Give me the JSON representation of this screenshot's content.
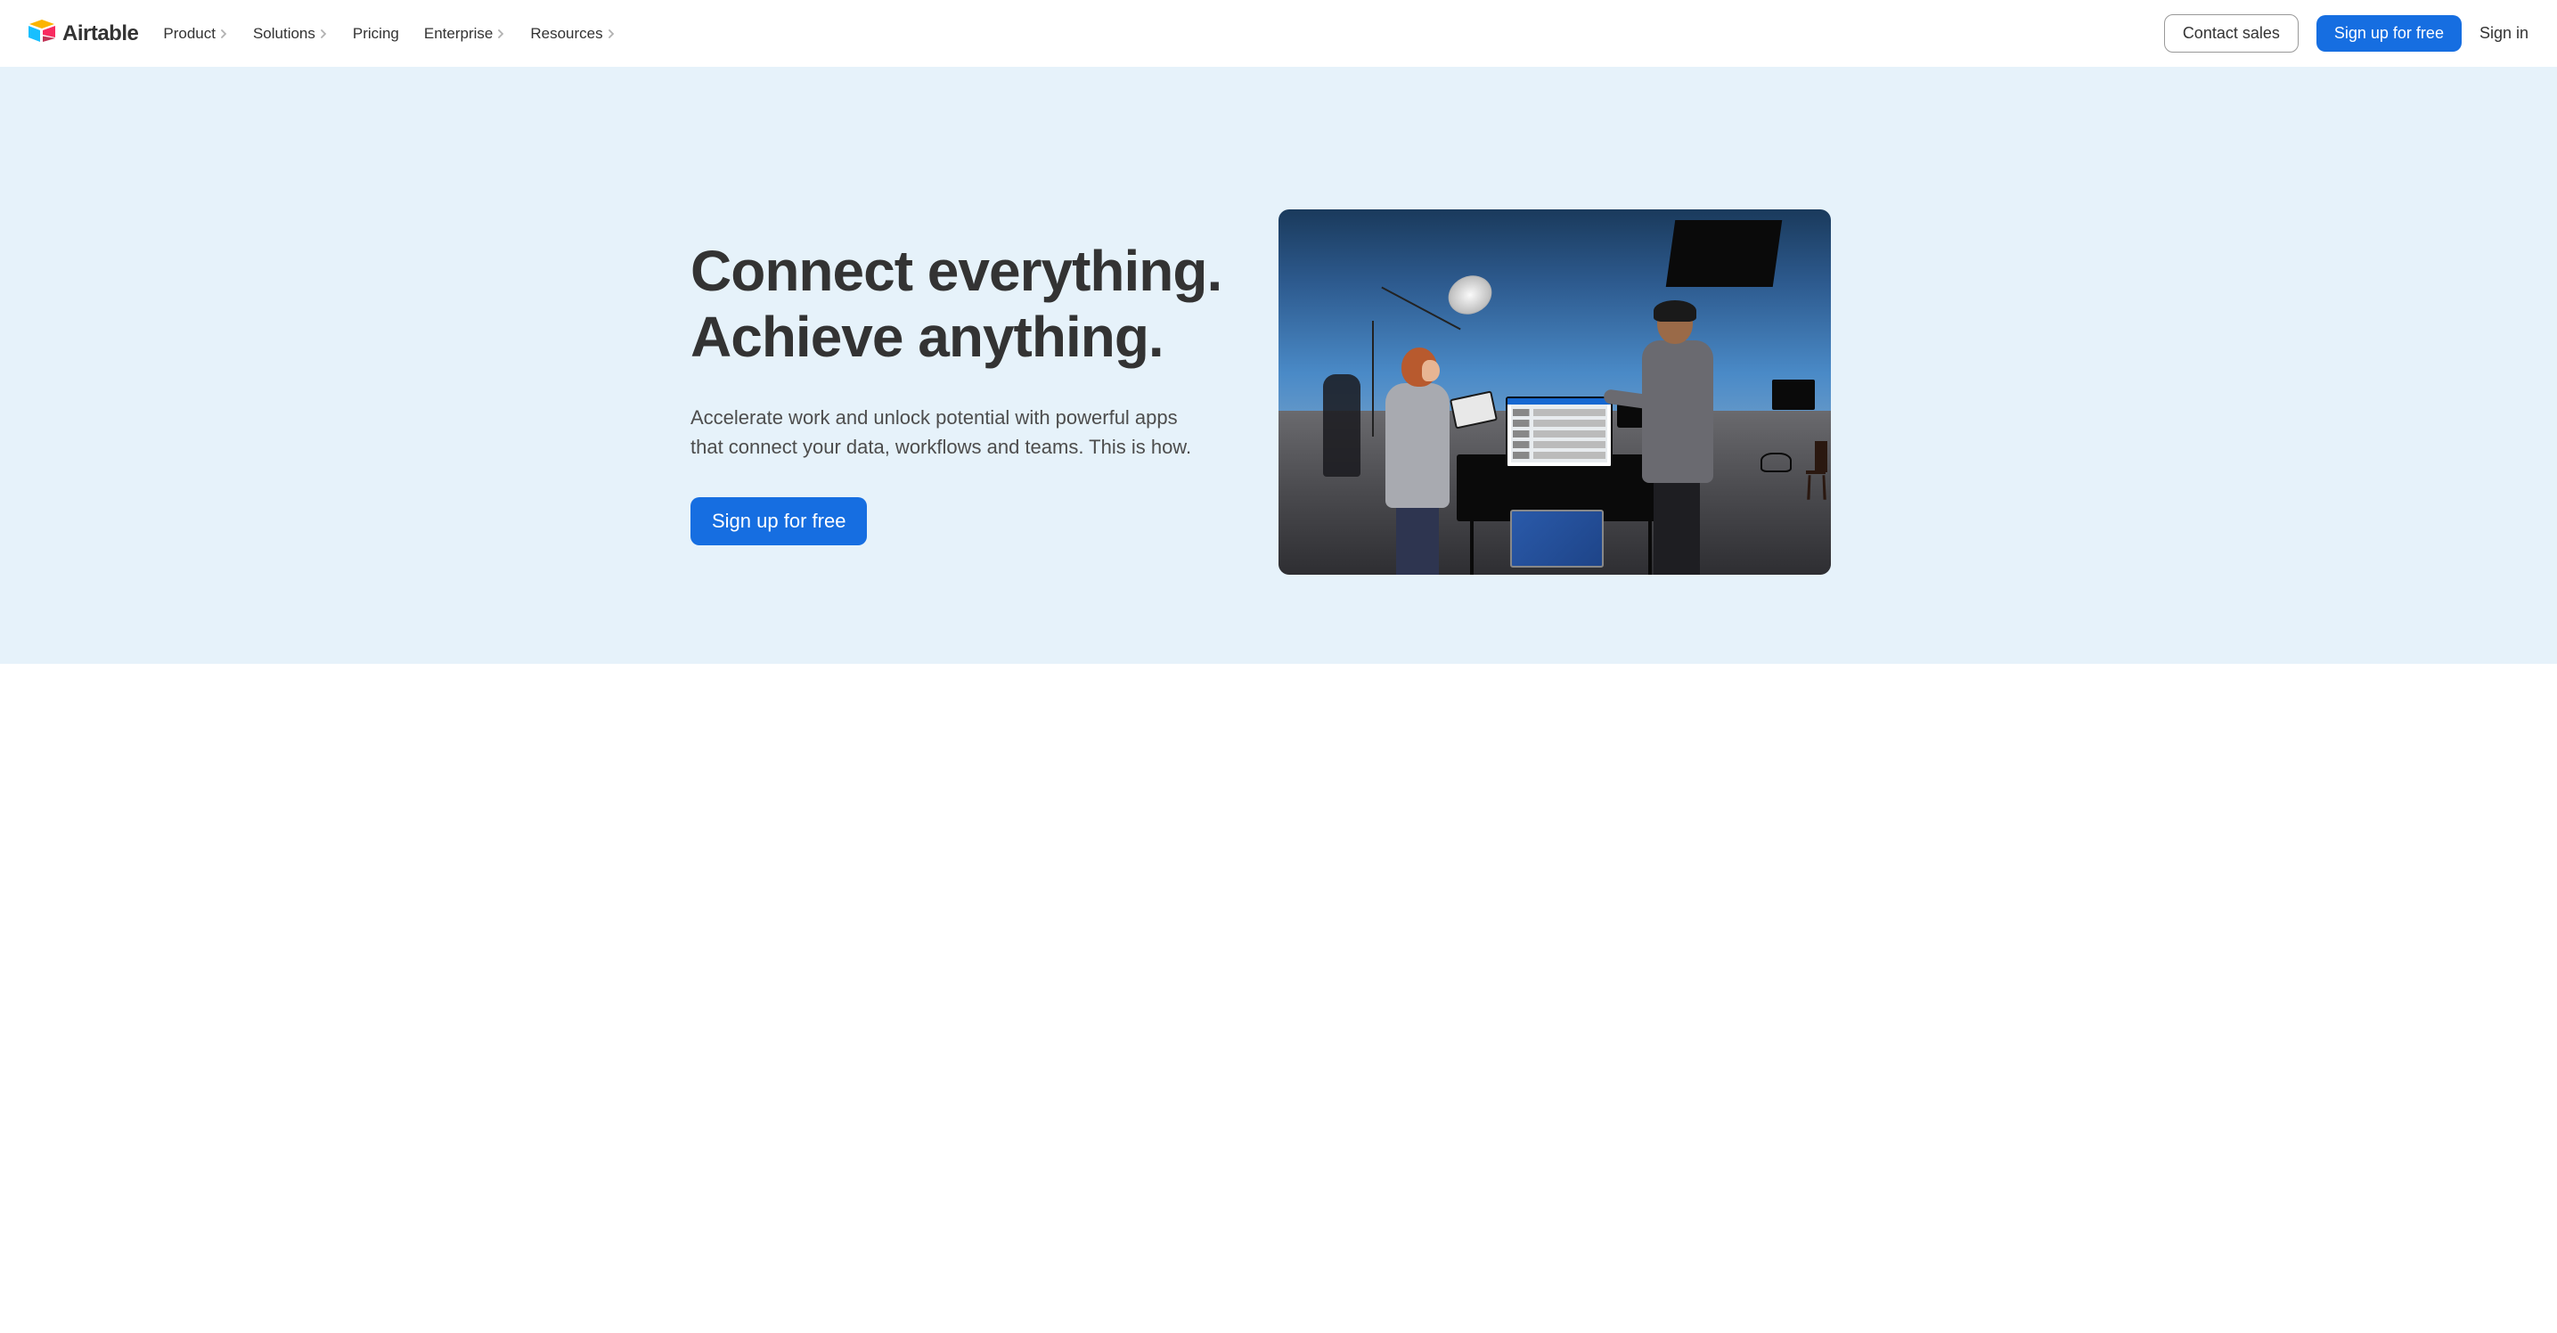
{
  "brand": {
    "name": "Airtable"
  },
  "nav": {
    "items": [
      {
        "label": "Product",
        "hasChevron": true
      },
      {
        "label": "Solutions",
        "hasChevron": true
      },
      {
        "label": "Pricing",
        "hasChevron": false
      },
      {
        "label": "Enterprise",
        "hasChevron": true
      },
      {
        "label": "Resources",
        "hasChevron": true
      }
    ]
  },
  "header": {
    "contactSales": "Contact sales",
    "signUp": "Sign up for free",
    "signIn": "Sign in"
  },
  "hero": {
    "title": "Connect everything. Achieve anything.",
    "subtitle": "Accelerate work and unlock potential with powerful apps that connect your data, workflows and teams. This is how.",
    "cta": "Sign up for free"
  },
  "colors": {
    "primary": "#166ee1",
    "heroBg": "#e6f2fa"
  }
}
